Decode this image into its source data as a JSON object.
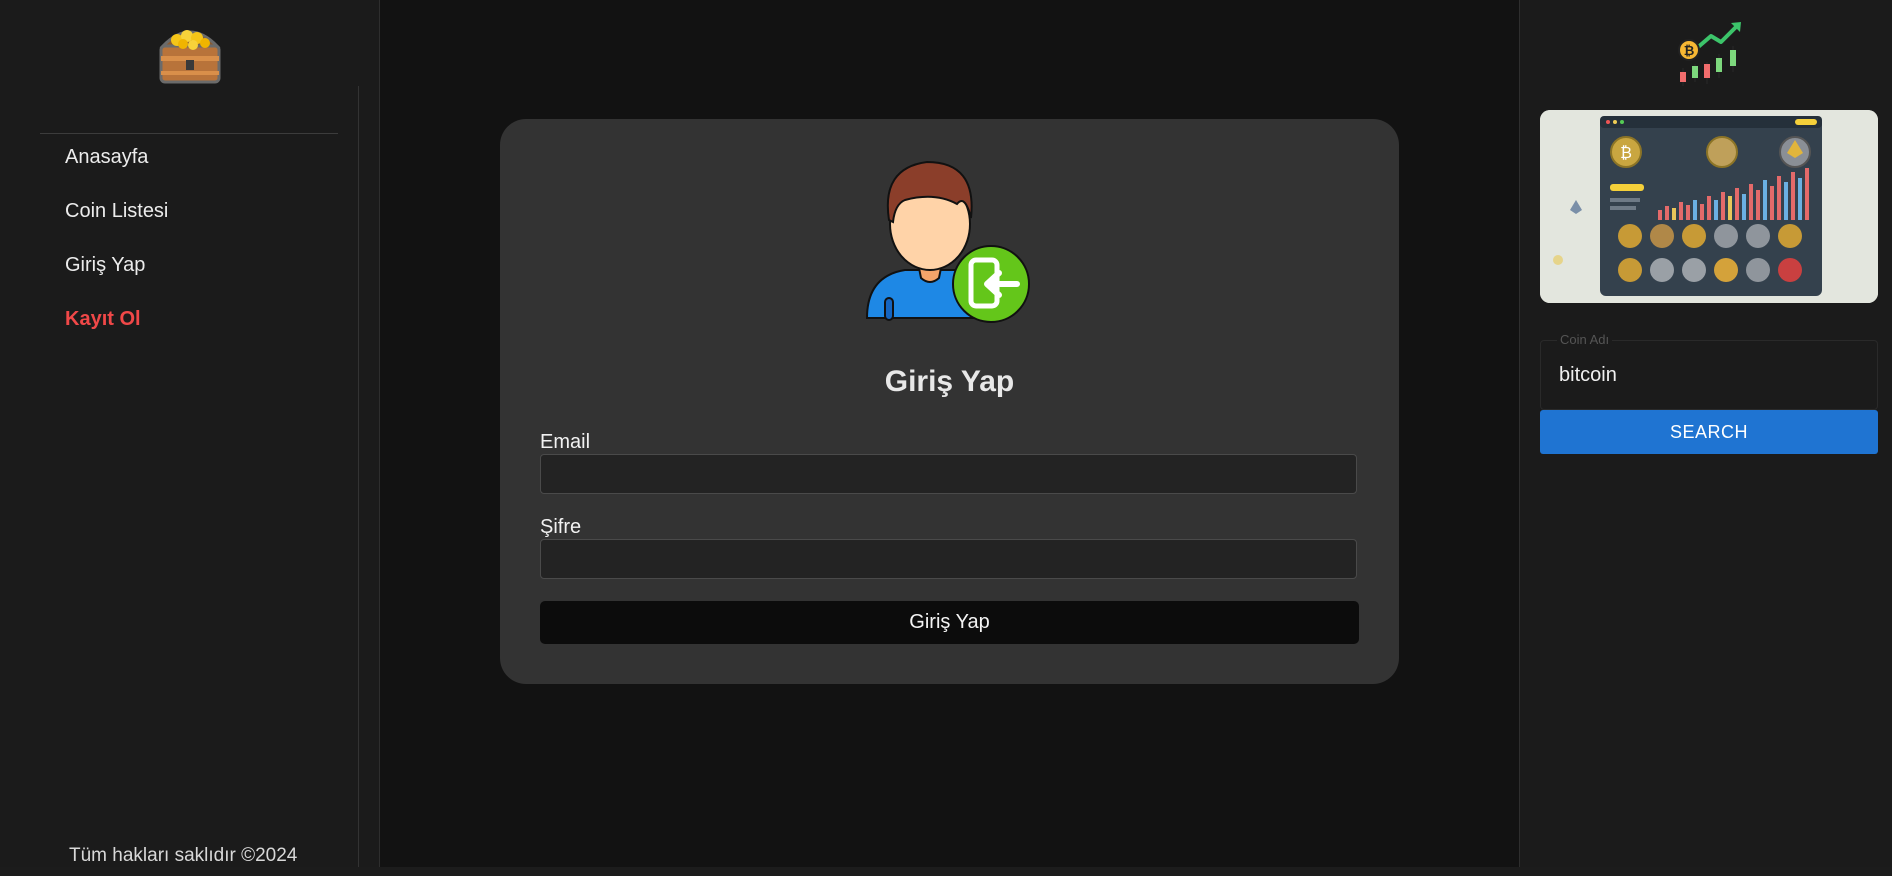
{
  "sidebar": {
    "logo_icon": "treasure-chest-icon",
    "items": [
      {
        "label": "Anasayfa"
      },
      {
        "label": "Coin Listesi"
      },
      {
        "label": "Giriş Yap"
      },
      {
        "label": "Kayıt Ol",
        "active": true
      }
    ],
    "footer": "Tüm hakları saklıdır ©2024"
  },
  "login": {
    "avatar_icon": "user-login-icon",
    "title": "Giriş Yap",
    "email_label": "Email",
    "email_value": "",
    "password_label": "Şifre",
    "password_value": "",
    "submit_label": "Giriş Yap"
  },
  "right_panel": {
    "chart_icon": "crypto-chart-icon",
    "preview_image": "crypto-dashboard-illustration",
    "search": {
      "legend": "Coin Adı",
      "value": "bitcoin",
      "button_label": "SEARCH"
    }
  },
  "colors": {
    "background": "#121212",
    "sidebar": "#1b1b1b",
    "card": "#333333",
    "active_nav": "#f04848",
    "search_button": "#1f74d2"
  }
}
